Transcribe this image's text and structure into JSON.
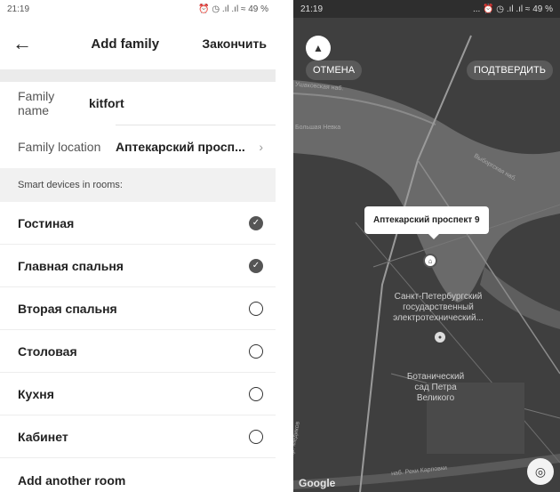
{
  "left": {
    "status": {
      "time": "21:19",
      "icons": "⏰ ◷ .ıl .ıl ≈ 49 %"
    },
    "header": {
      "back_icon": "arrow-left-icon",
      "title": "Add family",
      "finish": "Закончить"
    },
    "family_name": {
      "label": "Family name",
      "value": "kitfort"
    },
    "family_location": {
      "label": "Family location",
      "value": "Аптекарский просп..."
    },
    "section_title": "Smart devices in rooms:",
    "rooms": [
      {
        "name": "Гостиная",
        "checked": true
      },
      {
        "name": "Главная спальня",
        "checked": true
      },
      {
        "name": "Вторая спальня",
        "checked": false
      },
      {
        "name": "Столовая",
        "checked": false
      },
      {
        "name": "Кухня",
        "checked": false
      },
      {
        "name": "Кабинет",
        "checked": false
      }
    ],
    "add_room": "Add another room"
  },
  "right": {
    "status": {
      "time": "21:19",
      "icons": "... ⏰ ◷ .ıl .ıl ≈ 49 %"
    },
    "cancel": "ОТМЕНА",
    "confirm": "ПОДТВЕРДИТЬ",
    "callout": "Аптекарский проспект 9",
    "poi_university": "Санкт-Петербургский\nгосударственный\nэлектротехнический...",
    "poi_garden": "Ботанический\nсад Петра\nВеликого",
    "streets": {
      "ushakovskaya": "Ушаковская наб.",
      "bolshaya_nevka": "Большая Невка",
      "vyborgskaya": "Выборгская наб.",
      "medikov": "пр. Медиков",
      "karpovki": "наб. Реки Карповки"
    },
    "google": "Google"
  }
}
